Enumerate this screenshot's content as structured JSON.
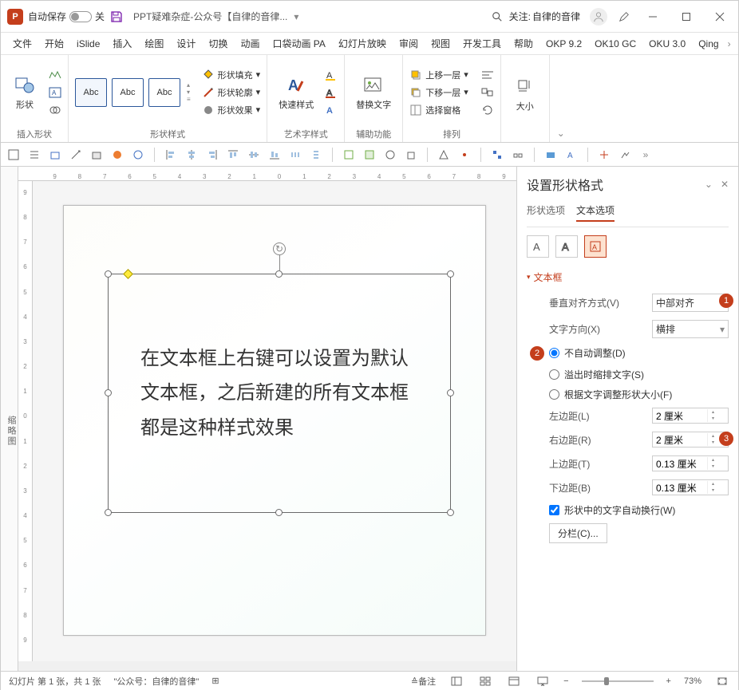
{
  "title_bar": {
    "app_letter": "P",
    "autosave_label": "自动保存",
    "autosave_state": "关",
    "doc_title": "PPT疑难杂症-公众号【自律的音律...",
    "attention": "关注:",
    "attention_name": "自律的音律"
  },
  "tabs": [
    "文件",
    "开始",
    "iSlide",
    "插入",
    "绘图",
    "设计",
    "切换",
    "动画",
    "口袋动画 PA",
    "幻灯片放映",
    "审阅",
    "视图",
    "开发工具",
    "帮助",
    "OKP 9.2",
    "OK10 GC",
    "OKU 3.0",
    "Qing"
  ],
  "ribbon": {
    "group1": "插入形状",
    "shapes_btn": "形状",
    "group2": "形状样式",
    "style_label": "Abc",
    "fill": "形状填充",
    "outline": "形状轮廓",
    "effect": "形状效果",
    "group3": "艺术字样式",
    "quick_style": "快速样式",
    "group4": "辅助功能",
    "alt_text": "替换文字",
    "group5": "排列",
    "bring_fwd": "上移一层",
    "send_back": "下移一层",
    "sel_pane": "选择窗格",
    "group6": "大小",
    "size_btn": "大小"
  },
  "collapsed_panel": "缩略图",
  "ruler_h": [
    "9",
    "8",
    "7",
    "6",
    "5",
    "4",
    "3",
    "2",
    "1",
    "0",
    "1",
    "2",
    "3",
    "4",
    "5",
    "6",
    "7",
    "8",
    "9"
  ],
  "ruler_v": [
    "9",
    "8",
    "7",
    "6",
    "5",
    "4",
    "3",
    "2",
    "1",
    "0",
    "1",
    "2",
    "3",
    "4",
    "5",
    "6",
    "7",
    "8",
    "9"
  ],
  "slide_text": "在文本框上右键可以设置为默认文本框，之后新建的所有文本框都是这种样式效果",
  "right_pane": {
    "title": "设置形状格式",
    "tab_shape": "形状选项",
    "tab_text": "文本选项",
    "section": "文本框",
    "valign_label": "垂直对齐方式(V)",
    "valign_value": "中部对齐",
    "direction_label": "文字方向(X)",
    "direction_value": "横排",
    "autofit_none": "不自动调整(D)",
    "autofit_shrink": "溢出时缩排文字(S)",
    "autofit_resize": "根据文字调整形状大小(F)",
    "margin_l_label": "左边距(L)",
    "margin_l_value": "2 厘米",
    "margin_r_label": "右边距(R)",
    "margin_r_value": "2 厘米",
    "margin_t_label": "上边距(T)",
    "margin_t_value": "0.13 厘米",
    "margin_b_label": "下边距(B)",
    "margin_b_value": "0.13 厘米",
    "wrap": "形状中的文字自动换行(W)",
    "columns": "分栏(C)..."
  },
  "status": {
    "slide_info": "幻灯片 第 1 张，共 1 张",
    "author": "\"公众号：自律的音律\"",
    "notes": "备注",
    "zoom": "73%"
  }
}
